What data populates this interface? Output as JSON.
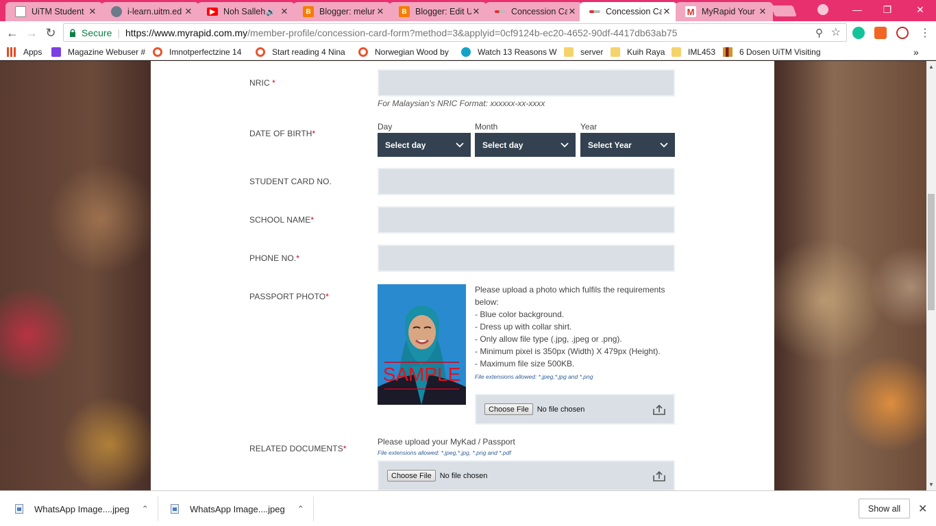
{
  "browser": {
    "tabs": [
      {
        "title": "UiTM Student",
        "favicon": "document-icon",
        "color": "#7a7a7a",
        "active": false
      },
      {
        "title": "i-learn.uitm.ed",
        "favicon": "globe-icon",
        "color": "#6c7a8a",
        "active": false
      },
      {
        "title": "Noh Salleh",
        "favicon": "youtube-icon",
        "color": "#ff0000",
        "active": false,
        "muted": true
      },
      {
        "title": "Blogger: melur",
        "favicon": "blogger-icon",
        "color": "#f57d00",
        "active": false
      },
      {
        "title": "Blogger: Edit U",
        "favicon": "blogger-icon",
        "color": "#f57d00",
        "active": false
      },
      {
        "title": "Concession Ca",
        "favicon": "myrapid-icon",
        "color": "#c0c0c0",
        "active": false
      },
      {
        "title": "Concession Ca",
        "favicon": "myrapid-icon",
        "color": "#c0c0c0",
        "active": true
      },
      {
        "title": "MyRapid Your",
        "favicon": "gmail-icon",
        "color": "#d93025",
        "active": false
      }
    ],
    "tab_close_glyph": "✕",
    "mute_glyph": "🔊",
    "address": {
      "secure_label": "Secure",
      "url_host": "https://www.myrapid.com.my",
      "url_path": "/member-profile/concession-card-form?method=3&applyid=0cf9124b-ec20-4652-90df-4417db63ab75"
    },
    "bookmarks": [
      {
        "label": "Apps",
        "icon": "apps-grid-icon",
        "color": "#e34c26"
      },
      {
        "label": "Magazine Webuser #",
        "icon": "magazine-icon",
        "color": "#7b3fe4"
      },
      {
        "label": "Imnotperfectzine 14",
        "icon": "wattpad-icon",
        "color": "#e8542f"
      },
      {
        "label": "Start reading 4 Nina",
        "icon": "wattpad-icon",
        "color": "#e8542f"
      },
      {
        "label": "Norwegian Wood by",
        "icon": "wattpad-icon",
        "color": "#e8542f"
      },
      {
        "label": "Watch 13 Reasons W",
        "icon": "play-icon",
        "color": "#14a3c7"
      },
      {
        "label": "server",
        "icon": "folder-icon",
        "color": "#f5d36b"
      },
      {
        "label": "Kuih Raya",
        "icon": "folder-icon",
        "color": "#f5d36b"
      },
      {
        "label": "IML453",
        "icon": "folder-icon",
        "color": "#f5d36b"
      },
      {
        "label": "6 Dosen UiTM Visiting",
        "icon": "books-icon",
        "color": "#c79a2b"
      }
    ],
    "more_bookmarks": "»"
  },
  "form": {
    "nric_label": "NRIC",
    "required_mark": "*",
    "nric_hint": "For Malaysian's NRIC Format: xxxxxx-xx-xxxx",
    "dob_label": "DATE OF BIRTH",
    "dob": {
      "day_label": "Day",
      "day_value": "Select day",
      "month_label": "Month",
      "month_value": "Select day",
      "year_label": "Year",
      "year_value": "Select Year"
    },
    "student_card_label": "STUDENT CARD NO.",
    "school_name_label": "SCHOOL NAME",
    "phone_label": "PHONE NO.",
    "passport_photo_label": "PASSPORT PHOTO",
    "sample_text": "SAMPLE",
    "photo_requirements": [
      "Please upload a photo which fulfils the requirements",
      "below:",
      "- Blue color background.",
      "- Dress up with collar shirt.",
      "- Only allow file type (.jpg, .jpeg or .png).",
      "- Minimum pixel is 350px (Width) X 479px (Height).",
      "- Maximum file size 500KB."
    ],
    "photo_extensions": "File extensions allowed: *.jpeg,*.jpg and *.png",
    "choose_file": "Choose File",
    "no_file": "No file chosen",
    "related_docs_label": "RELATED DOCUMENTS",
    "related_docs_note": "Please upload your MyKad / Passport",
    "related_docs_extensions": "File extensions allowed: *.jpeg,*.jpg, *.png and *.pdf"
  },
  "downloads": {
    "items": [
      {
        "name": "WhatsApp Image....jpeg"
      },
      {
        "name": "WhatsApp Image....jpeg"
      }
    ],
    "show_all": "Show all"
  },
  "colors": {
    "chrome_pink": "#e8306e",
    "select_bg": "#334150",
    "field_bg": "#d9dfe5",
    "required": "#d0021b"
  }
}
